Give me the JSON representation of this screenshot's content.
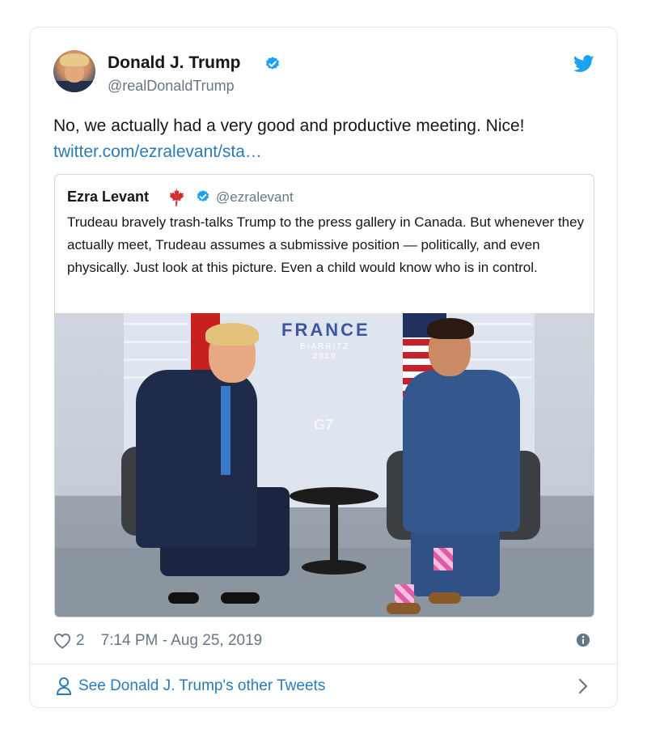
{
  "tweet": {
    "author_name": "Donald J. Trump",
    "author_handle": "@realDonaldTrump",
    "text": "No, we actually had a very good and productive meeting. Nice!",
    "link": "twitter.com/ezralevant/sta…",
    "likes": "2",
    "timestamp": "7:14 PM - Aug 25, 2019"
  },
  "quote": {
    "author_name": "Ezra Levant",
    "author_handle": "@ezralevant",
    "text": "Trudeau bravely trash-talks Trump to the press gallery in Canada. But whenever they actually meet, Trudeau assumes a submissive position — politically, and even physically. Just look at this picture. Even a child would know who is in control.",
    "photo_backdrop_title": "FRANCE",
    "photo_backdrop_subtitle": "BIARRITZ",
    "photo_backdrop_year": "2019",
    "photo_backdrop_logo": "G7"
  },
  "footer": {
    "label": "See Donald J. Trump's other Tweets"
  },
  "colors": {
    "link": "#2b7bb9",
    "verified": "#1da1f2",
    "twitter_brand": "#1da1f2",
    "secondary_text": "#657786",
    "maple_leaf": "#d32f2f"
  },
  "icons": [
    "verified-badge-icon",
    "twitter-bird-icon",
    "maple-leaf-icon",
    "heart-icon",
    "info-icon",
    "person-icon",
    "chevron-right-icon"
  ]
}
